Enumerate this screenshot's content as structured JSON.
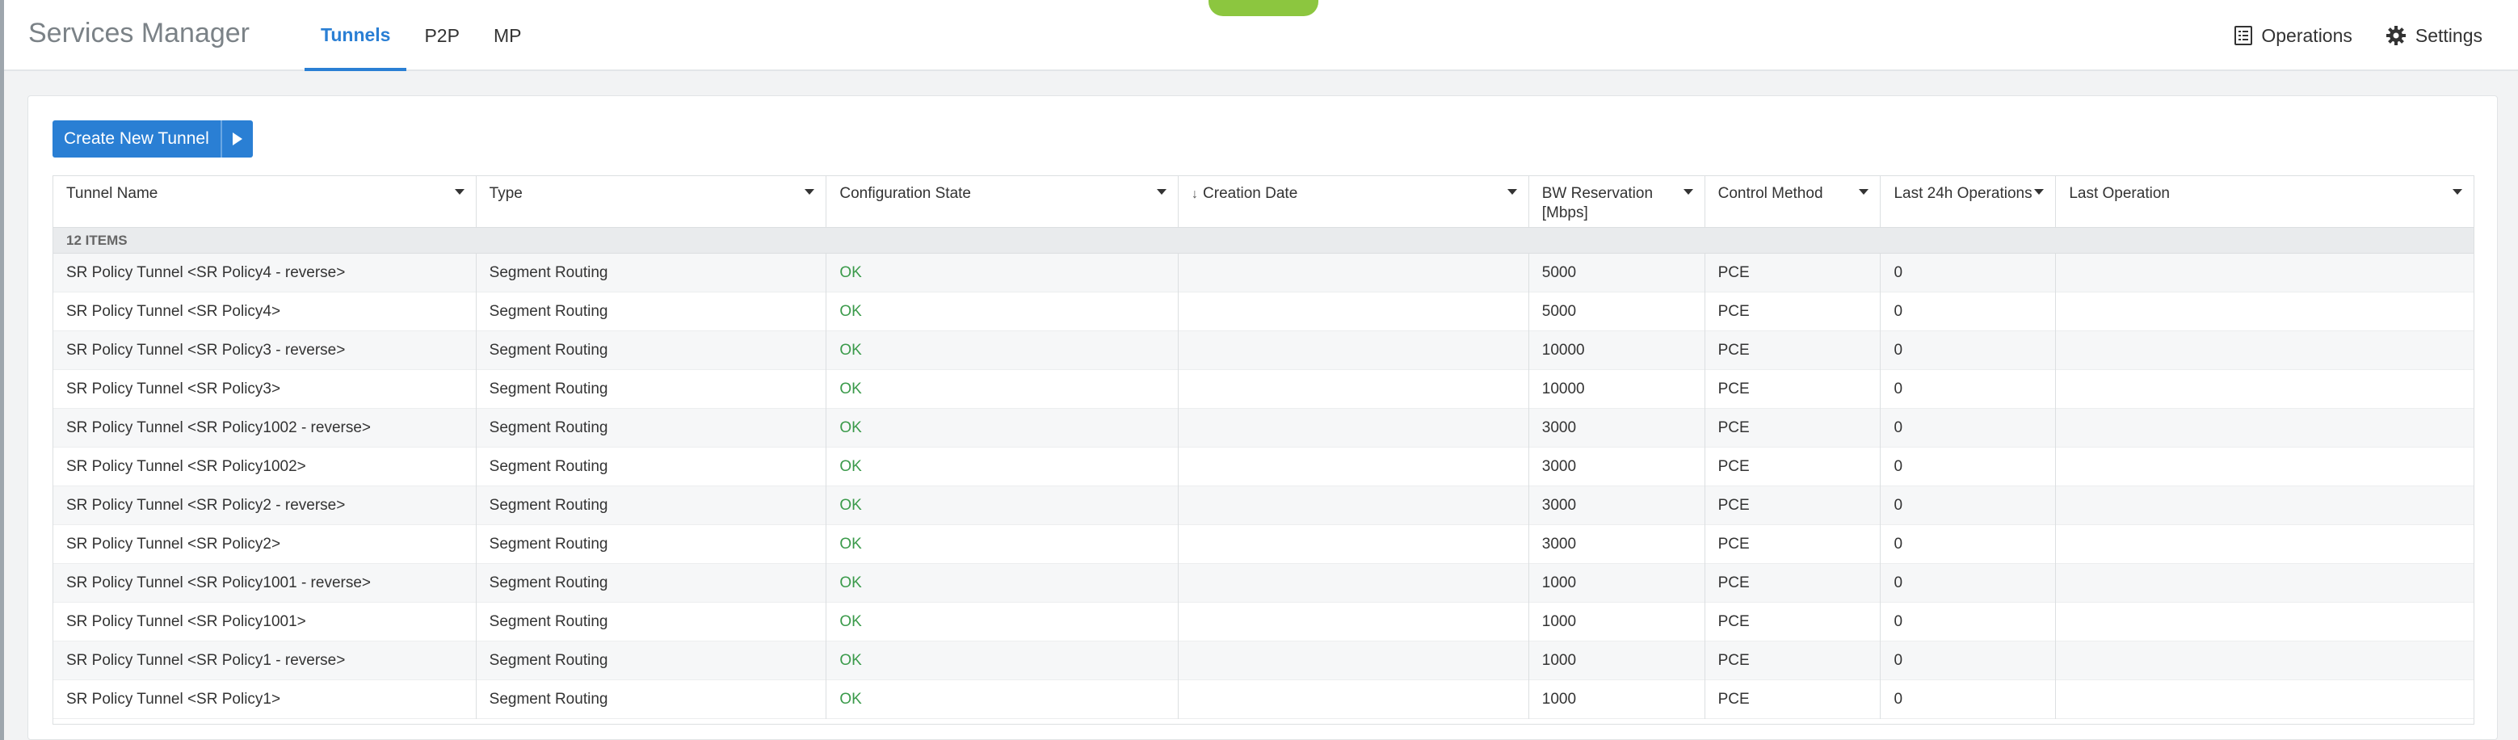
{
  "app": {
    "title": "Services Manager"
  },
  "tabs": [
    {
      "label": "Tunnels",
      "active": true
    },
    {
      "label": "P2P",
      "active": false
    },
    {
      "label": "MP",
      "active": false
    }
  ],
  "header_actions": {
    "operations_label": "Operations",
    "settings_label": "Settings"
  },
  "toolbar": {
    "create_label": "Create New Tunnel"
  },
  "table": {
    "columns": [
      {
        "label": "Tunnel Name"
      },
      {
        "label": "Type"
      },
      {
        "label": "Configuration State"
      },
      {
        "label": "Creation Date",
        "sort": "descending"
      },
      {
        "label": "BW Reservation [Mbps]"
      },
      {
        "label": "Control Method"
      },
      {
        "label": "Last 24h Operations"
      },
      {
        "label": "Last Operation"
      }
    ],
    "group_label": "12 ITEMS",
    "rows": [
      {
        "name": "SR Policy Tunnel <SR Policy4 - reverse>",
        "type": "Segment Routing",
        "state": "OK",
        "date": "",
        "bw": "5000",
        "method": "PCE",
        "ops24": "0",
        "last": ""
      },
      {
        "name": "SR Policy Tunnel <SR Policy4>",
        "type": "Segment Routing",
        "state": "OK",
        "date": "",
        "bw": "5000",
        "method": "PCE",
        "ops24": "0",
        "last": ""
      },
      {
        "name": "SR Policy Tunnel <SR Policy3 - reverse>",
        "type": "Segment Routing",
        "state": "OK",
        "date": "",
        "bw": "10000",
        "method": "PCE",
        "ops24": "0",
        "last": ""
      },
      {
        "name": "SR Policy Tunnel <SR Policy3>",
        "type": "Segment Routing",
        "state": "OK",
        "date": "",
        "bw": "10000",
        "method": "PCE",
        "ops24": "0",
        "last": ""
      },
      {
        "name": "SR Policy Tunnel <SR Policy1002 - reverse>",
        "type": "Segment Routing",
        "state": "OK",
        "date": "",
        "bw": "3000",
        "method": "PCE",
        "ops24": "0",
        "last": ""
      },
      {
        "name": "SR Policy Tunnel <SR Policy1002>",
        "type": "Segment Routing",
        "state": "OK",
        "date": "",
        "bw": "3000",
        "method": "PCE",
        "ops24": "0",
        "last": ""
      },
      {
        "name": "SR Policy Tunnel <SR Policy2 - reverse>",
        "type": "Segment Routing",
        "state": "OK",
        "date": "",
        "bw": "3000",
        "method": "PCE",
        "ops24": "0",
        "last": ""
      },
      {
        "name": "SR Policy Tunnel <SR Policy2>",
        "type": "Segment Routing",
        "state": "OK",
        "date": "",
        "bw": "3000",
        "method": "PCE",
        "ops24": "0",
        "last": ""
      },
      {
        "name": "SR Policy Tunnel <SR Policy1001 - reverse>",
        "type": "Segment Routing",
        "state": "OK",
        "date": "",
        "bw": "1000",
        "method": "PCE",
        "ops24": "0",
        "last": ""
      },
      {
        "name": "SR Policy Tunnel <SR Policy1001>",
        "type": "Segment Routing",
        "state": "OK",
        "date": "",
        "bw": "1000",
        "method": "PCE",
        "ops24": "0",
        "last": ""
      },
      {
        "name": "SR Policy Tunnel <SR Policy1 - reverse>",
        "type": "Segment Routing",
        "state": "OK",
        "date": "",
        "bw": "1000",
        "method": "PCE",
        "ops24": "0",
        "last": ""
      },
      {
        "name": "SR Policy Tunnel <SR Policy1>",
        "type": "Segment Routing",
        "state": "OK",
        "date": "",
        "bw": "1000",
        "method": "PCE",
        "ops24": "0",
        "last": ""
      }
    ]
  },
  "colors": {
    "accent": "#2a7fd4",
    "ok": "#3a9a4a",
    "status_pill": "#8cc63f"
  },
  "icons": {
    "operations": "list-icon",
    "settings": "gear-icon",
    "create_menu": "play-triangle-icon",
    "column_menu": "caret-down-icon",
    "sort": "arrow-down-icon"
  }
}
